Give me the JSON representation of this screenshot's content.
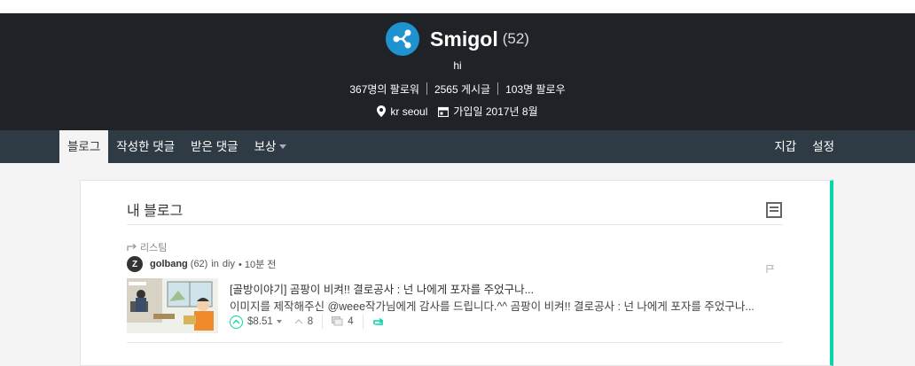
{
  "profile": {
    "name": "Smigol",
    "reputation": "(52)",
    "about": "hi",
    "followers": "367명의 팔로워",
    "posts": "2565 게시글",
    "following": "103명 팔로우",
    "location": "kr seoul",
    "joined": "가입일 2017년 8월"
  },
  "nav": {
    "left": [
      "블로그",
      "작성한 댓글",
      "받은 댓글",
      "보상"
    ],
    "right": [
      "지갑",
      "설정"
    ]
  },
  "main": {
    "title": "내 블로그",
    "post": {
      "resteem_label": "리스팀",
      "author": "golbang",
      "author_rep": "(62)",
      "category_prefix": "in",
      "category": "diy",
      "time": "• 10분 전",
      "title": "[골방이야기] 곰팡이 비켜!! 결로공사 : 넌 나에게 포자를 주었구나...",
      "body": "이미지를 제작해주신 @weee작가님에게 감사를 드립니다.^^ 곰팡이 비켜!! 결로공사 : 넌 나에게 포자를 주었구나...",
      "payout": "$8.51",
      "votes": "8",
      "comments": "4"
    }
  },
  "colors": {
    "accent": "#06d6a9",
    "header_bg": "#1f2327",
    "nav_bg": "#2e3b44",
    "avatar": "#1f93cf"
  }
}
